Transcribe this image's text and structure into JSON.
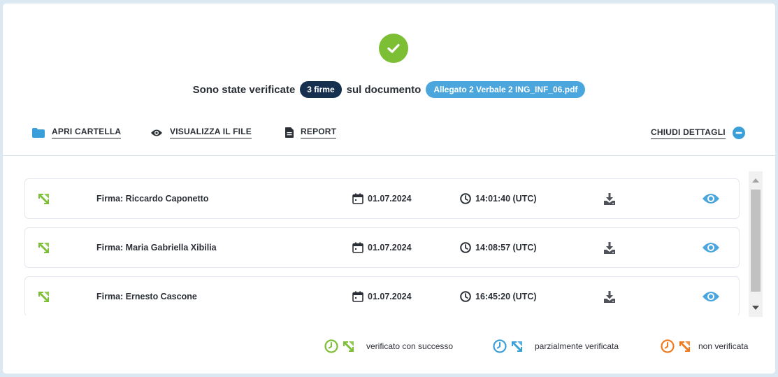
{
  "header": {
    "status_prefix": "Sono state verificate",
    "signatures_count": "3 firme",
    "status_middle": "sul documento",
    "document_name": "Allegato 2 Verbale 2 ING_INF_06.pdf"
  },
  "toolbar": {
    "open_folder": "APRI CARTELLA",
    "view_file": "VISUALIZZA IL FILE",
    "report": "REPORT",
    "close_details": "CHIUDI DETTAGLI"
  },
  "signatures": [
    {
      "label": "Firma: Riccardo Caponetto",
      "date": "01.07.2024",
      "time": "14:01:40 (UTC)",
      "status": "verified"
    },
    {
      "label": "Firma: Maria Gabriella Xibilia",
      "date": "01.07.2024",
      "time": "14:08:57 (UTC)",
      "status": "verified"
    },
    {
      "label": "Firma: Ernesto Cascone",
      "date": "01.07.2024",
      "time": "16:45:20 (UTC)",
      "status": "verified"
    }
  ],
  "legend": {
    "success": "verificato con successo",
    "partial": "parzialmente verificata",
    "failed": "non verificata"
  },
  "colors": {
    "success": "#7cbf35",
    "partial": "#3a9fd8",
    "failed": "#f07a1f",
    "pill_dark": "#17304f",
    "pill_blue": "#4aa6dd"
  }
}
